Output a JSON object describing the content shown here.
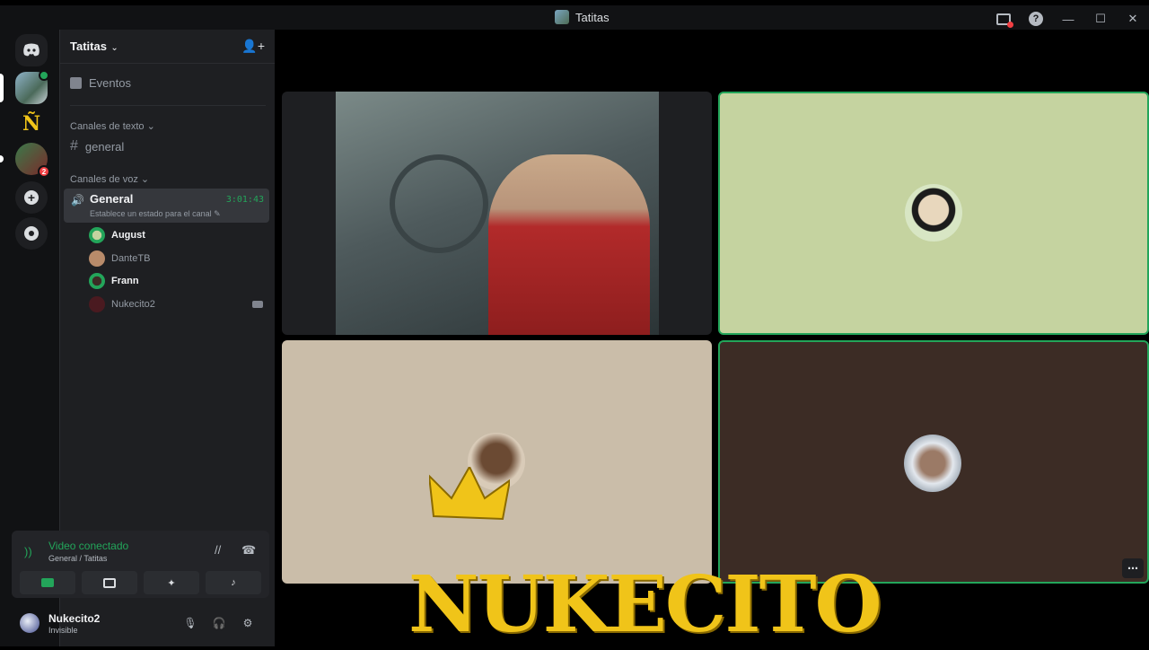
{
  "window": {
    "title": "Tatitas"
  },
  "server": {
    "name": "Tatitas"
  },
  "sidebar": {
    "events_label": "Eventos",
    "text_category": "Canales de texto",
    "text_channel": "general",
    "voice_category": "Canales de voz",
    "voice_channel": {
      "name": "General",
      "timer": "3:01:43",
      "status_prompt": "Establece un estado para el canal"
    },
    "members": [
      {
        "name": "August",
        "bold": true
      },
      {
        "name": "DanteTB",
        "bold": false
      },
      {
        "name": "Frann",
        "bold": true
      },
      {
        "name": "Nukecito2",
        "bold": false,
        "camera": true
      }
    ]
  },
  "guild_badges": {
    "server3_unread": "2"
  },
  "rtc": {
    "status": "Video conectado",
    "location": "General / Tatitas"
  },
  "user": {
    "name": "Nukecito2",
    "status": "Invisible"
  },
  "stream_overlay": {
    "text": "NUKECITO"
  },
  "colors": {
    "accent_green": "#23a55a",
    "tile_2_bg": "#c5d3a0",
    "tile_3_bg": "#cabda9",
    "tile_4_bg": "#3c2c25",
    "overlay_gold": "#f0c419"
  }
}
